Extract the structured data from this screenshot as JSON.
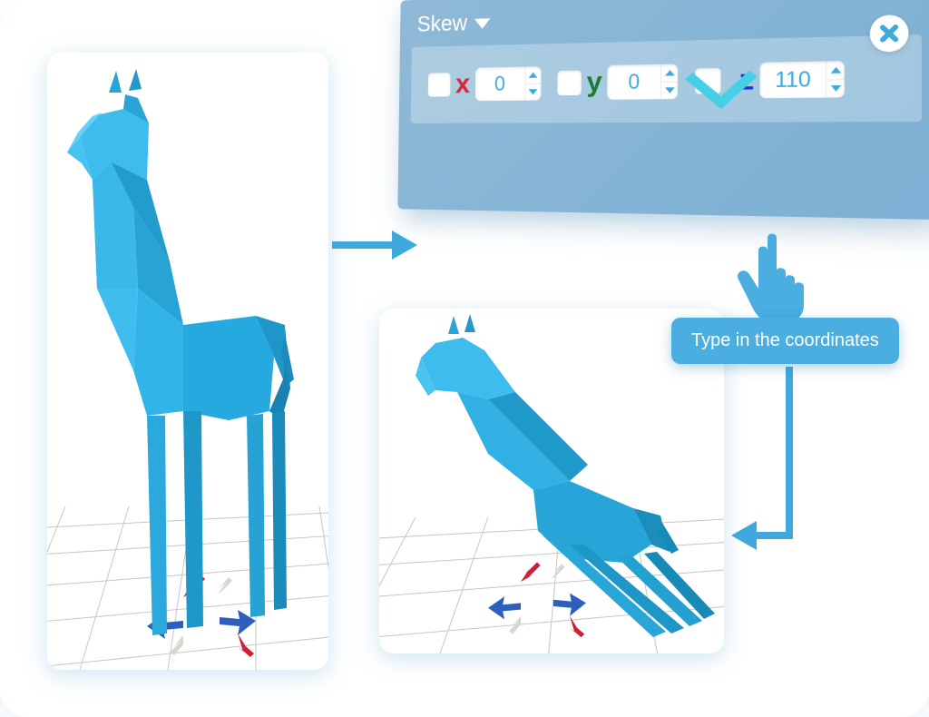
{
  "panel": {
    "title": "Skew",
    "close_label": "✖",
    "axes": {
      "x": {
        "label": "x",
        "value": "0",
        "checked": false
      },
      "y": {
        "label": "y",
        "value": "0",
        "checked": false
      },
      "z": {
        "label": "z",
        "value": "110",
        "checked": true
      }
    }
  },
  "tooltip": {
    "text": "Type in the coordinates"
  },
  "viewports": {
    "before": {
      "subject": "giraffe-upright"
    },
    "after": {
      "subject": "giraffe-skewed"
    }
  },
  "colors": {
    "accent": "#3fa9de",
    "panel_bg": "#8fb9d6",
    "check": "#45d0e8"
  }
}
